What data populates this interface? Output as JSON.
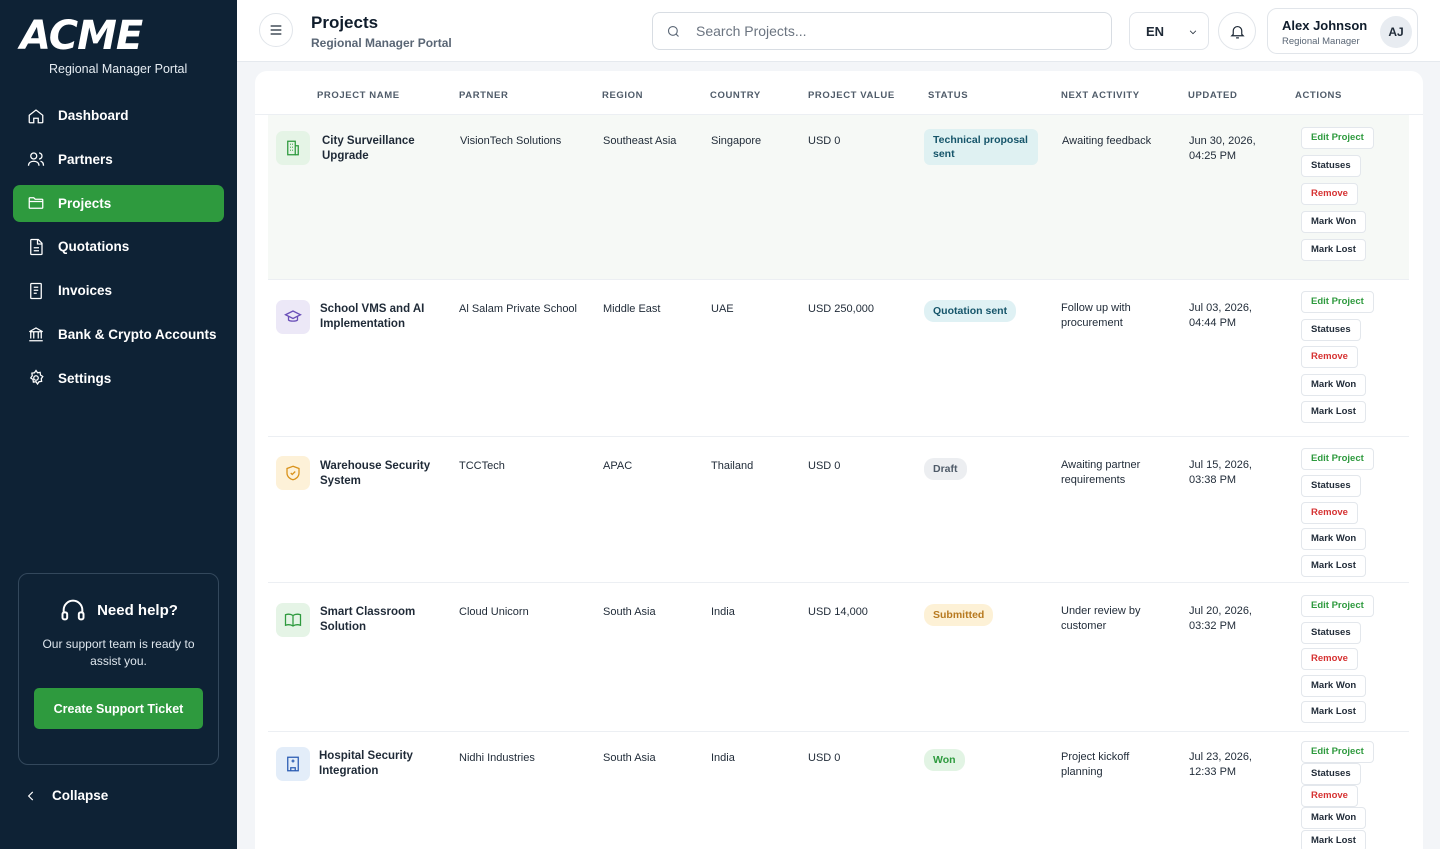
{
  "brand": {
    "logo": "ACME",
    "subtitle": "Regional Manager Portal"
  },
  "sidebar": {
    "items": [
      {
        "label": "Dashboard",
        "icon": "home-icon",
        "active": false
      },
      {
        "label": "Partners",
        "icon": "users-icon",
        "active": false
      },
      {
        "label": "Projects",
        "icon": "folder-icon",
        "active": true
      },
      {
        "label": "Quotations",
        "icon": "document-icon",
        "active": false
      },
      {
        "label": "Invoices",
        "icon": "receipt-icon",
        "active": false
      },
      {
        "label": "Bank & Crypto Accounts",
        "icon": "bank-icon",
        "active": false
      },
      {
        "label": "Settings",
        "icon": "gear-icon",
        "active": false
      }
    ],
    "help": {
      "title": "Need help?",
      "text": "Our support team is ready to assist you.",
      "button": "Create Support Ticket"
    },
    "collapse_label": "Collapse"
  },
  "header": {
    "title": "Projects",
    "subtitle": "Regional Manager Portal",
    "search_placeholder": "Search Projects...",
    "language": "EN",
    "user": {
      "name": "Alex Johnson",
      "role": "Regional Manager",
      "initials": "AJ"
    }
  },
  "table": {
    "columns": [
      "PROJECT NAME",
      "PARTNER",
      "REGION",
      "COUNTRY",
      "PROJECT VALUE",
      "STATUS",
      "NEXT ACTIVITY",
      "UPDATED",
      "ACTIONS"
    ],
    "action_labels": {
      "edit": "Edit Project",
      "statuses": "Statuses",
      "remove": "Remove",
      "won": "Mark Won",
      "lost": "Mark Lost"
    },
    "rows": [
      {
        "name": "City Surveillance Upgrade",
        "partner": "VisionTech Solutions",
        "region": "Southeast Asia",
        "country": "Singapore",
        "value": "USD 0",
        "status": "Technical proposal sent",
        "next": "Awaiting feedback",
        "updated": "Jun 30, 2026, 04:25 PM",
        "icon": "building-icon"
      },
      {
        "name": "School VMS and AI Implementation",
        "partner": "Al Salam Private School",
        "region": "Middle East",
        "country": "UAE",
        "value": "USD 250,000",
        "status": "Quotation sent",
        "next": "Follow up with procurement",
        "updated": "Jul 03, 2026, 04:44 PM",
        "icon": "graduation-cap-icon"
      },
      {
        "name": "Warehouse Security System",
        "partner": "TCCTech",
        "region": "APAC",
        "country": "Thailand",
        "value": "USD 0",
        "status": "Draft",
        "next": "Awaiting partner requirements",
        "updated": "Jul 15, 2026, 03:38 PM",
        "icon": "shield-icon"
      },
      {
        "name": "Smart Classroom Solution",
        "partner": "Cloud Unicorn",
        "region": "South Asia",
        "country": "India",
        "value": "USD 14,000",
        "status": "Submitted",
        "next": "Under review by customer",
        "updated": "Jul 20, 2026, 03:32 PM",
        "icon": "book-icon"
      },
      {
        "name": "Hospital Security Integration",
        "partner": "Nidhi Industries",
        "region": "South Asia",
        "country": "India",
        "value": "USD 0",
        "status": "Won",
        "next": "Project kickoff planning",
        "updated": "Jul 23, 2026, 12:33 PM",
        "icon": "hospital-icon"
      }
    ]
  },
  "colors": {
    "sidebar_bg": "#0e2235",
    "accent_green": "#2e9a3e",
    "status_technical": "#dff1f2",
    "status_quotation": "#dff1f4",
    "status_draft": "#eceef1",
    "status_submitted": "#fdf1d6",
    "status_won": "#e2f4e4"
  }
}
